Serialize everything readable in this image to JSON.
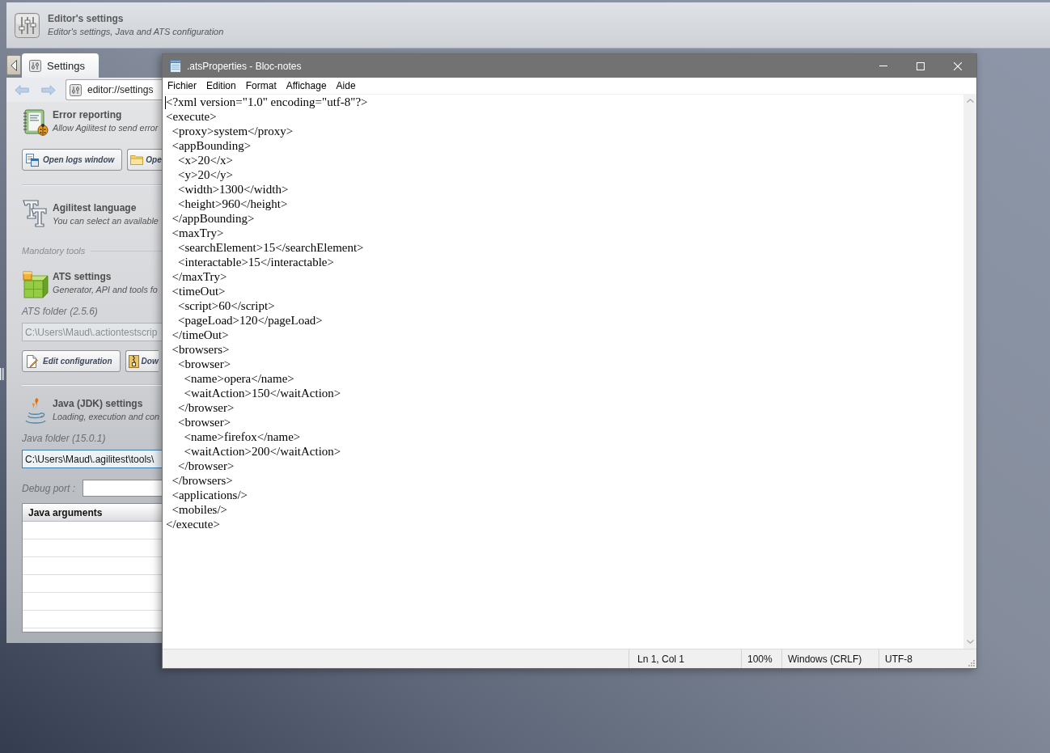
{
  "app_header": {
    "title": "Editor's settings",
    "subtitle": "Editor's settings, Java and ATS configuration"
  },
  "tabs": [
    {
      "label": "Settings",
      "selected": true
    }
  ],
  "address_bar": {
    "url": "editor://settings"
  },
  "settings": {
    "error_reporting": {
      "title": "Error reporting",
      "subtitle": "Allow Agilitest to send error",
      "buttons": [
        "Open logs window",
        "Ope"
      ]
    },
    "language": {
      "title": "Agilitest language",
      "subtitle": "You can select an available"
    },
    "group_label": "Mandatory tools",
    "ats": {
      "title": "ATS settings",
      "subtitle": "Generator, API and tools fo",
      "folder_label": "ATS folder (2.5.6)",
      "folder": {
        "value": "C:\\Users\\Maud\\.actiontestscrip",
        "disabled": true
      },
      "buttons": [
        "Edit configuration",
        "Dow"
      ]
    },
    "java": {
      "title": "Java (JDK) settings",
      "subtitle": "Loading, execution and con",
      "folder_label": "Java folder (15.0.1)",
      "folder": {
        "value": "C:\\Users\\Maud\\.agilitest\\tools\\",
        "disabled": false
      },
      "debug_port_label": "Debug port :",
      "arguments_table": {
        "columns": [
          "Java arguments"
        ]
      }
    }
  },
  "notepad": {
    "title": ".atsProperties - Bloc-notes",
    "menu": [
      "Fichier",
      "Edition",
      "Format",
      "Affichage",
      "Aide"
    ],
    "lines": [
      "<?xml version=\"1.0\" encoding=\"utf-8\"?>",
      "<execute>",
      "  <proxy>system</proxy>",
      "  <appBounding>",
      "    <x>20</x>",
      "    <y>20</y>",
      "    <width>1300</width>",
      "    <height>960</height>",
      "  </appBounding>",
      "  <maxTry>",
      "    <searchElement>15</searchElement>",
      "    <interactable>15</interactable>",
      "  </maxTry>",
      "  <timeOut>",
      "    <script>60</script>",
      "    <pageLoad>120</pageLoad>",
      "  </timeOut>",
      "  <browsers>",
      "    <browser>",
      "      <name>opera</name>",
      "      <waitAction>150</waitAction>",
      "    </browser>",
      "    <browser>",
      "      <name>firefox</name>",
      "      <waitAction>200</waitAction>",
      "    </browser>",
      "  </browsers>",
      "  <applications/>",
      "  <mobiles/>",
      "</execute>"
    ],
    "status_bar": {
      "position": "Ln 1, Col 1",
      "zoom": "100%",
      "line_ending": "Windows (CRLF)",
      "encoding": "UTF-8"
    }
  }
}
